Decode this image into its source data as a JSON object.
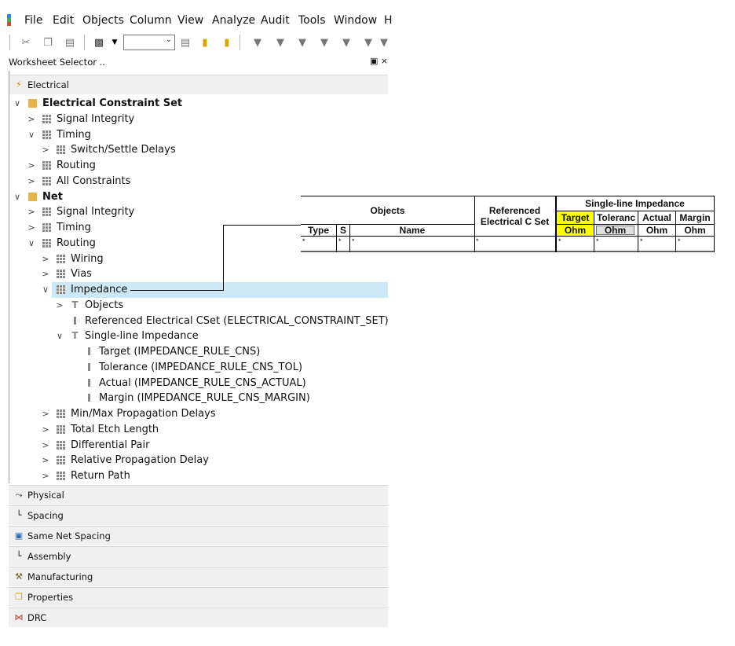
{
  "menu": [
    "File",
    "Edit",
    "Objects",
    "Column",
    "View",
    "Analyze",
    "Audit",
    "Tools",
    "Window",
    "H"
  ],
  "pane": {
    "title": "Worksheet Selector ..",
    "controls": "▣ ×"
  },
  "sections": {
    "electrical": "Electrical",
    "bottom": [
      {
        "label": "Physical",
        "icon": "physical-icon",
        "glyph": "⤳"
      },
      {
        "label": "Spacing",
        "icon": "spacing-icon",
        "glyph": "└"
      },
      {
        "label": "Same Net Spacing",
        "icon": "same-net-spacing-icon",
        "glyph": "▣"
      },
      {
        "label": "Assembly",
        "icon": "assembly-icon",
        "glyph": "└"
      },
      {
        "label": "Manufacturing",
        "icon": "manufacturing-icon",
        "glyph": "⚒"
      },
      {
        "label": "Properties",
        "icon": "properties-icon",
        "glyph": "❐"
      },
      {
        "label": "DRC",
        "icon": "drc-icon",
        "glyph": "⋈"
      }
    ]
  },
  "tree": [
    {
      "label": "Electrical Constraint Set",
      "icon": "folder",
      "twisty": "∨",
      "bold": true
    },
    {
      "label": "Signal Integrity",
      "icon": "grid",
      "twisty": ">"
    },
    {
      "label": "Timing",
      "icon": "grid",
      "twisty": "∨"
    },
    {
      "label": "Switch/Settle Delays",
      "icon": "grid",
      "twisty": ">"
    },
    {
      "label": "Routing",
      "icon": "grid",
      "twisty": ">"
    },
    {
      "label": "All Constraints",
      "icon": "grid",
      "twisty": ">"
    },
    {
      "label": "Net",
      "icon": "folder",
      "twisty": "∨",
      "bold": true
    },
    {
      "label": "Signal Integrity",
      "icon": "grid",
      "twisty": ">"
    },
    {
      "label": "Timing",
      "icon": "grid",
      "twisty": ">"
    },
    {
      "label": "Routing",
      "icon": "grid",
      "twisty": "∨"
    },
    {
      "label": "Wiring",
      "icon": "grid",
      "twisty": ">"
    },
    {
      "label": "Vias",
      "icon": "grid",
      "twisty": ">"
    },
    {
      "label": "Impedance",
      "icon": "grid",
      "twisty": "∨",
      "selected": true
    },
    {
      "label": "Objects",
      "icon": "t",
      "twisty": ">"
    },
    {
      "label": "Referenced Electrical CSet (ELECTRICAL_CONSTRAINT_SET)",
      "icon": "bar",
      "twisty": ""
    },
    {
      "label": "Single-line Impedance",
      "icon": "t",
      "twisty": "∨"
    },
    {
      "label": "Target (IMPEDANCE_RULE_CNS)",
      "icon": "bar",
      "twisty": ""
    },
    {
      "label": "Tolerance (IMPEDANCE_RULE_CNS_TOL)",
      "icon": "bar",
      "twisty": ""
    },
    {
      "label": "Actual (IMPEDANCE_RULE_CNS_ACTUAL)",
      "icon": "bar",
      "twisty": ""
    },
    {
      "label": "Margin (IMPEDANCE_RULE_CNS_MARGIN)",
      "icon": "bar",
      "twisty": ""
    },
    {
      "label": "Min/Max Propagation Delays",
      "icon": "grid",
      "twisty": ">"
    },
    {
      "label": "Total Etch Length",
      "icon": "grid",
      "twisty": ">"
    },
    {
      "label": "Differential Pair",
      "icon": "grid",
      "twisty": ">"
    },
    {
      "label": "Relative Propagation Delay",
      "icon": "grid",
      "twisty": ">"
    },
    {
      "label": "Return Path",
      "icon": "grid",
      "twisty": ">"
    }
  ],
  "sheet": {
    "objects": "Objects",
    "referenced": "Referenced Electrical C Set",
    "single_line": "Single-line Impedance",
    "cols": {
      "type": "Type",
      "s": "S",
      "name": "Name"
    },
    "imp_cols": [
      {
        "label": "Target",
        "unit": "Ohm",
        "highlight": "#ffff00"
      },
      {
        "label": "Toleranc",
        "unit": "Ohm"
      },
      {
        "label": "Actual",
        "unit": "Ohm"
      },
      {
        "label": "Margin",
        "unit": "Ohm"
      }
    ],
    "filter_star": "*"
  },
  "colors": {
    "selection": "#cde8f7",
    "target_highlight": "#ffff00",
    "folder": "#e6b34a"
  }
}
